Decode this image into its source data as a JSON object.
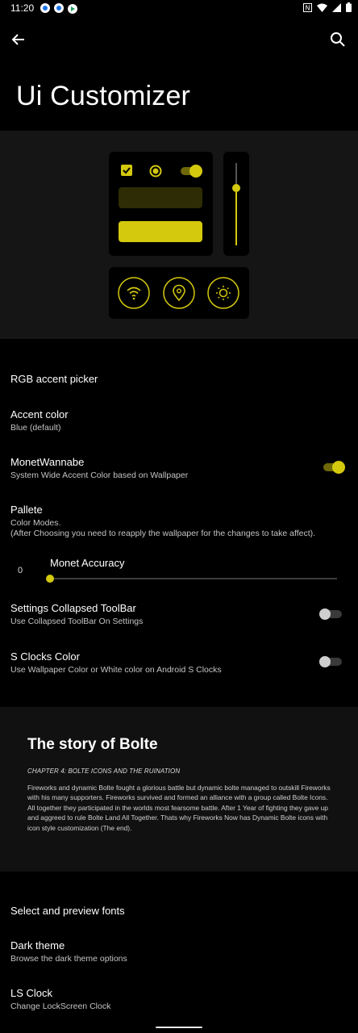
{
  "status_bar": {
    "time": "11:20"
  },
  "header": {
    "title": "Ui Customizer"
  },
  "colors": {
    "accent": "#d4c90d",
    "background": "#000000",
    "panel": "#151515",
    "secondary_text": "#c4c4c4"
  },
  "icons": {
    "back": "arrow-left-icon",
    "search": "search-icon",
    "preview": [
      "checkbox-icon",
      "radio-icon",
      "switch-icon",
      "wifi-icon",
      "location-icon",
      "brightness-icon"
    ]
  },
  "settings": {
    "rgb_picker": {
      "title": "RGB accent picker"
    },
    "accent_color": {
      "title": "Accent color",
      "summary": "Blue (default)"
    },
    "monet": {
      "title": "MonetWannabe",
      "summary": "System Wide Accent Color based on Wallpaper",
      "enabled": true
    },
    "pallete": {
      "title": "Pallete",
      "summary": "Color Modes.\n(After Choosing you need to reapply the wallpaper for the changes to take affect)."
    },
    "monet_accuracy": {
      "title": "Monet Accuracy",
      "value": "0"
    },
    "collapsed_toolbar": {
      "title": "Settings Collapsed ToolBar",
      "summary": "Use Collapsed ToolBar On Settings",
      "enabled": false
    },
    "s_clocks": {
      "title": "S Clocks Color",
      "summary": "Use Wallpaper Color or White color on Android S Clocks",
      "enabled": false
    },
    "fonts": {
      "title": "Select and preview fonts"
    },
    "dark_theme": {
      "title": "Dark theme",
      "summary": "Browse the dark theme options"
    },
    "ls_clock": {
      "title": "LS Clock",
      "summary": "Change LockScreen Clock"
    }
  },
  "story": {
    "title": "The story of Bolte",
    "chapter": "CHAPTER 4: BOLTE ICONS AND THE RUINATION",
    "body": "Fireworks and dynamic Bolte fought a glorious battle but dynamic bolte managed to outskill Fireworks with his many supporters. Fireworks survived and formed an alliance with a group called Bolte Icons. All together they participated in the worlds most fearsome battle. After 1 Year of fighting they gave up and aggreed to rule Bolte Land All Together. Thats why Fireworks Now has Dynamic Bolte icons with icon style customization (The end)."
  }
}
